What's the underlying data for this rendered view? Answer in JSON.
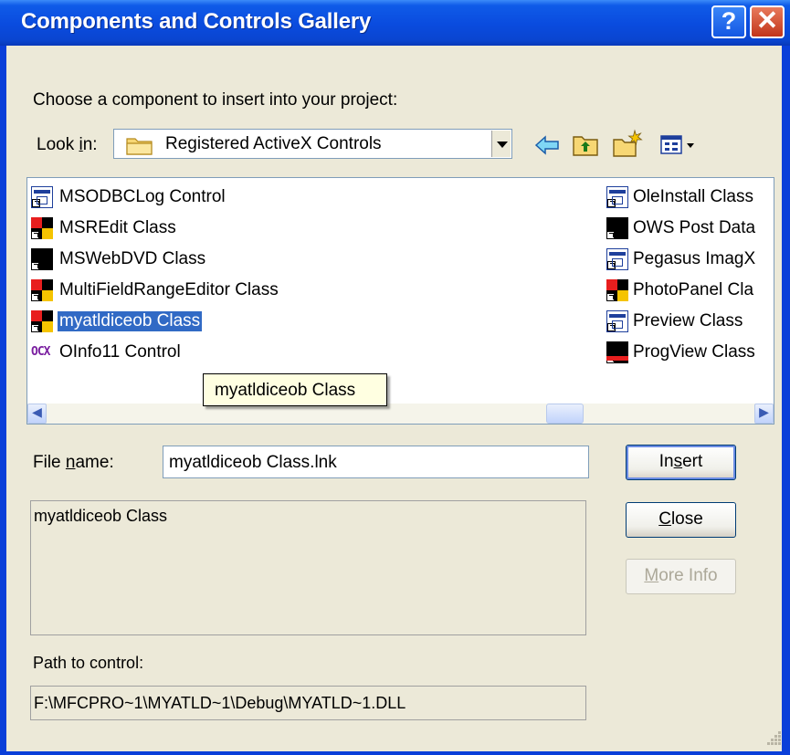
{
  "window": {
    "title": "Components and Controls Gallery",
    "help_glyph": "?",
    "close_glyph": "✕"
  },
  "prompt": "Choose a component to insert into your project:",
  "look_in": {
    "label_pre": "Look ",
    "label_accel": "i",
    "label_post": "n:",
    "value": "Registered ActiveX Controls",
    "folder_icon": "folder-icon"
  },
  "toolbar": {
    "back_glyph": "⇦",
    "icons": [
      "back-arrow-icon",
      "up-folder-icon",
      "new-folder-icon",
      "view-menu-icon"
    ]
  },
  "list": {
    "left_column": [
      {
        "label": "MSODBCLog Control",
        "icon": "application-icon"
      },
      {
        "label": "MSREdit Class",
        "icon": "puzzle-icon"
      },
      {
        "label": "MSWebDVD Class",
        "icon": "black-square-icon"
      },
      {
        "label": "MultiFieldRangeEditor Class",
        "icon": "puzzle-icon"
      },
      {
        "label": "myatldiceob Class",
        "icon": "puzzle-icon",
        "selected": true
      },
      {
        "label": "OInfo11 Control",
        "icon": "ocx-icon"
      }
    ],
    "right_column": [
      {
        "label": "OleInstall Class",
        "icon": "application-icon"
      },
      {
        "label": "OWS Post Data",
        "icon": "black-square-icon"
      },
      {
        "label": "Pegasus ImagX",
        "icon": "application-icon"
      },
      {
        "label": "PhotoPanel Cla",
        "icon": "puzzle-icon"
      },
      {
        "label": "Preview Class",
        "icon": "application-icon"
      },
      {
        "label": "ProgView Class",
        "icon": "progview-icon"
      }
    ],
    "ocx_text": "OCX",
    "scroll_left": "◀",
    "scroll_right": "▶"
  },
  "tooltip": "myatldiceob Class",
  "file_name": {
    "label_pre": "File ",
    "label_accel": "n",
    "label_post": "ame:",
    "value": "myatldiceob Class.lnk"
  },
  "description": "myatldiceob Class",
  "path": {
    "label": "Path to control:",
    "value": "F:\\MFCPRO~1\\MYATLD~1\\Debug\\MYATLD~1.DLL"
  },
  "buttons": {
    "insert": {
      "pre": "In",
      "accel": "s",
      "post": "ert"
    },
    "close": {
      "pre": "",
      "accel": "C",
      "post": "lose"
    },
    "more_info": {
      "pre": "",
      "accel": "M",
      "post": "ore Info"
    }
  }
}
